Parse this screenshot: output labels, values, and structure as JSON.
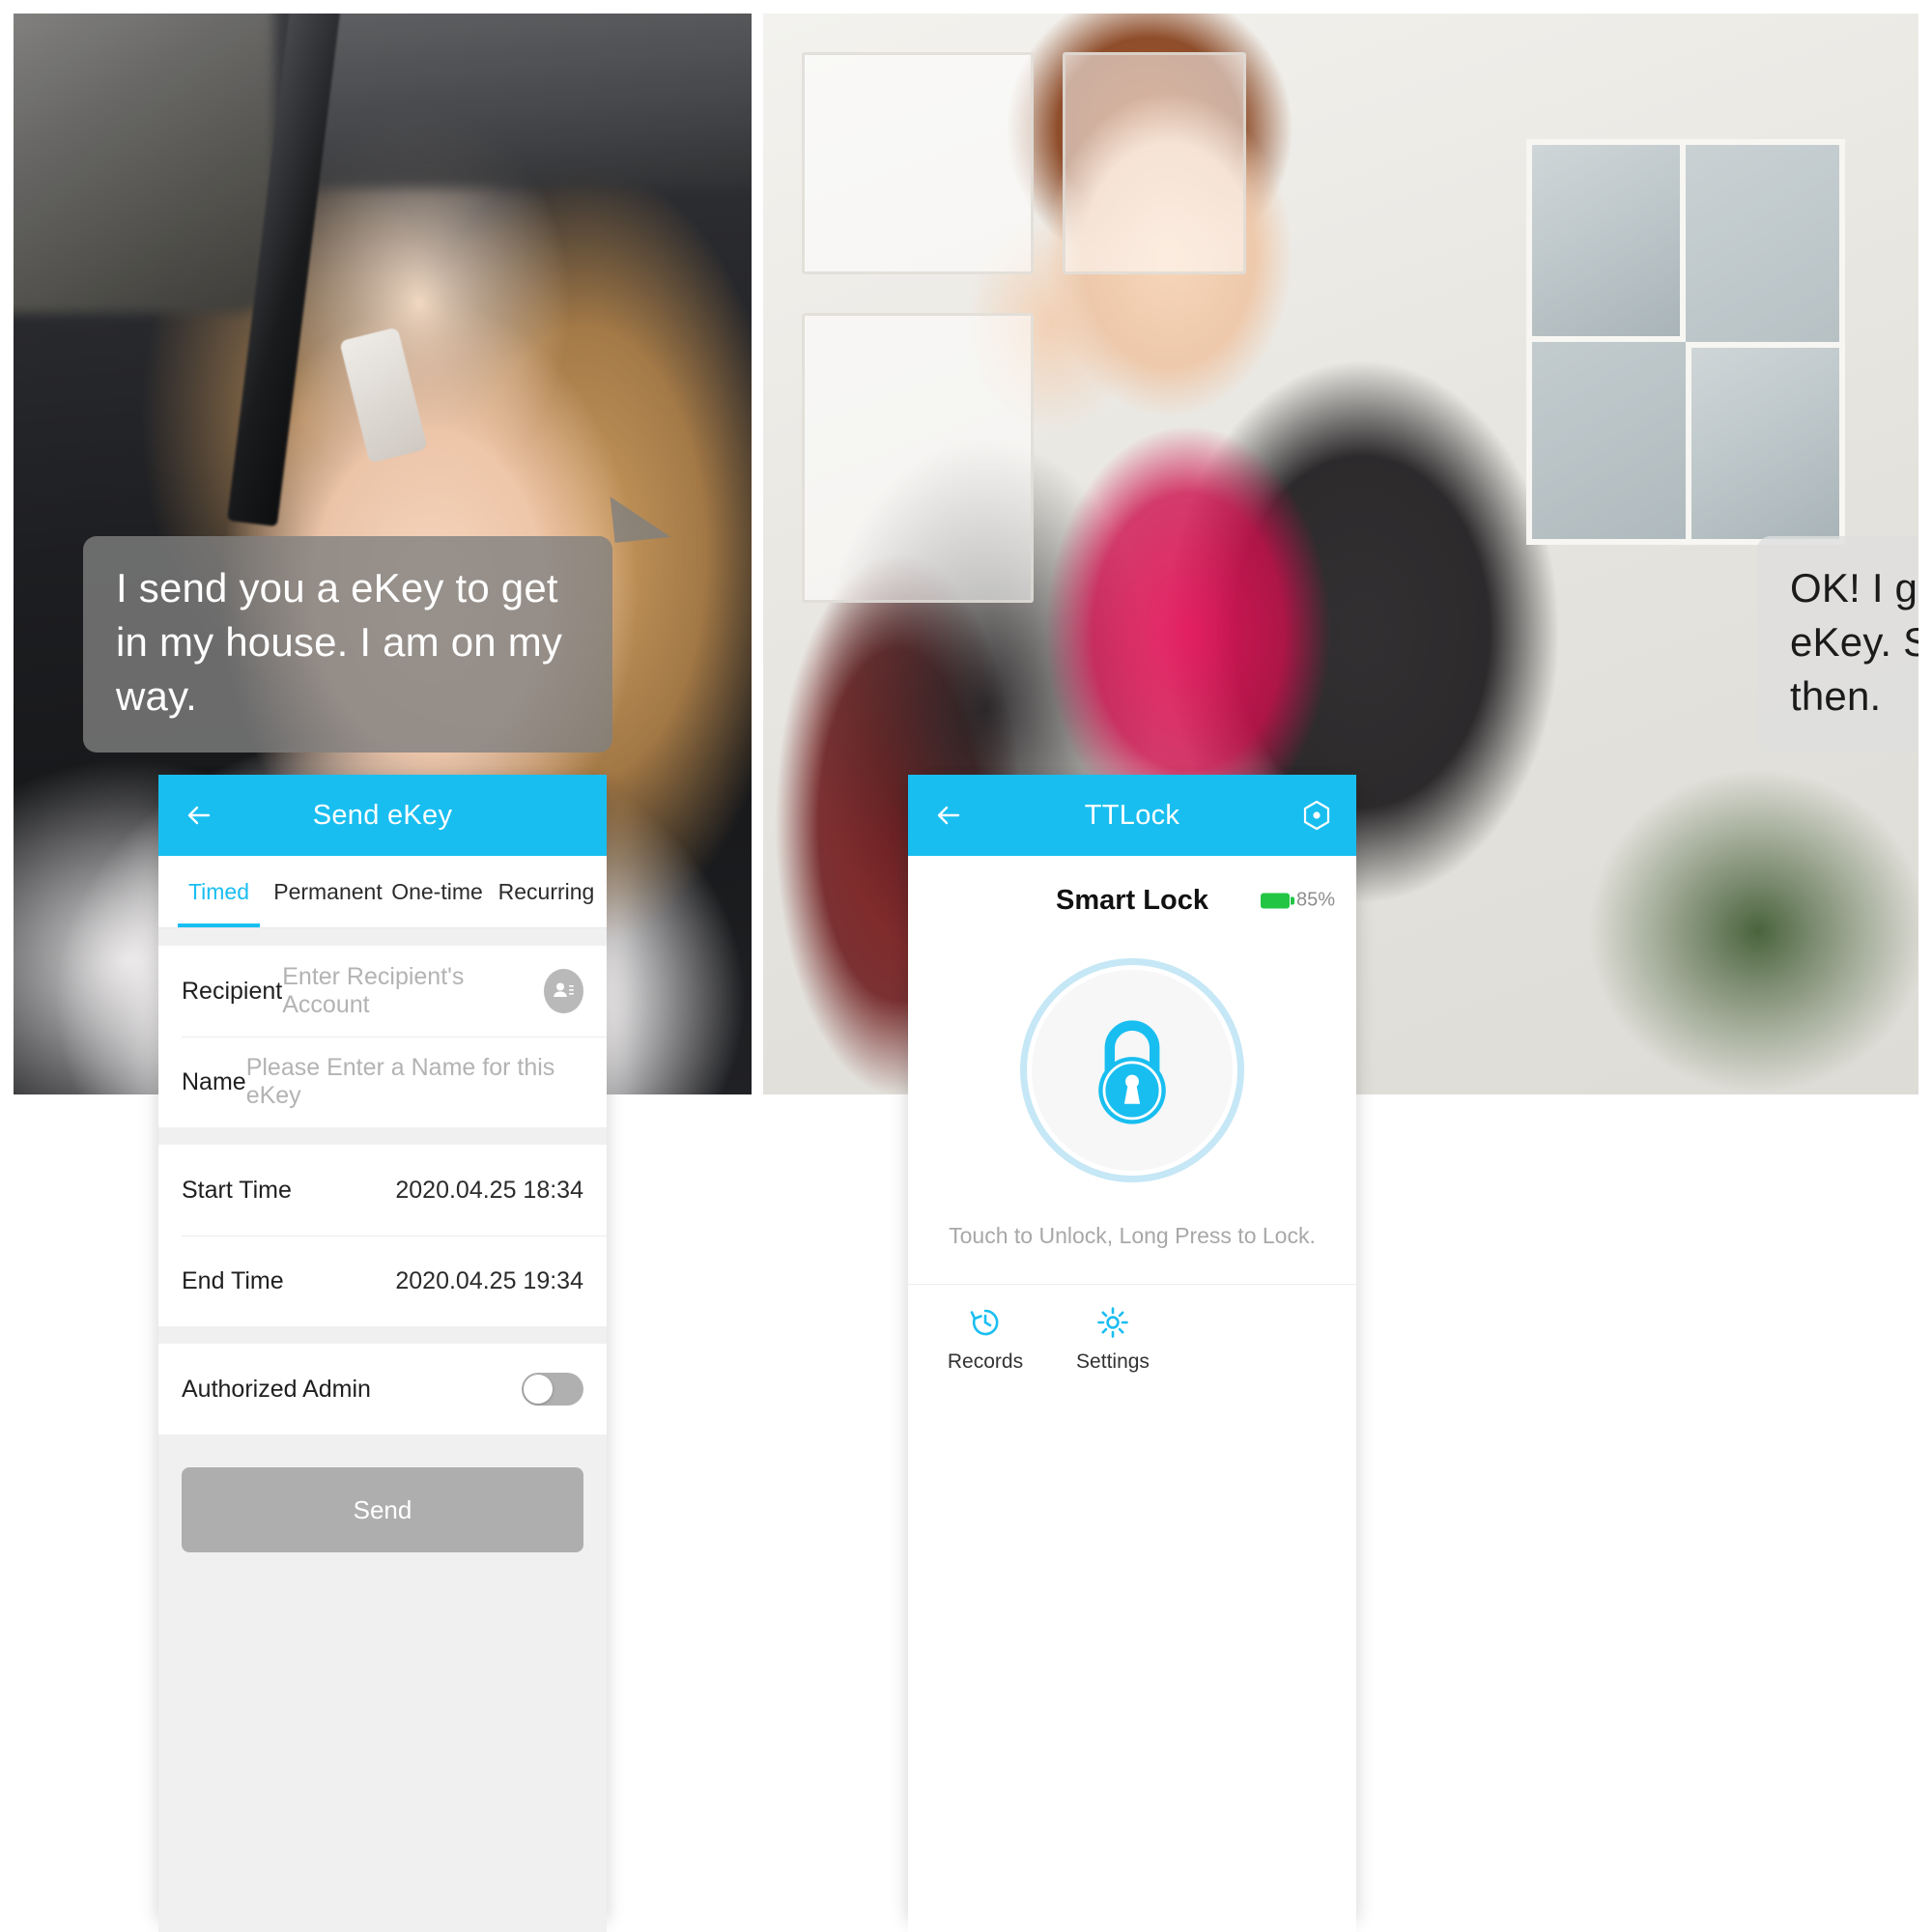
{
  "photos": {
    "left": {
      "alt": "woman-on-phone-in-car"
    },
    "right": {
      "alt": "woman-on-phone-at-front-door"
    }
  },
  "bubbles": {
    "left": {
      "text": "I send you a eKey to get in my house. I am on my way.",
      "bg": "#808080",
      "color": "#ffffff"
    },
    "right": {
      "text": "OK! I got the eKey. See you then.",
      "bg": "#dedede",
      "color": "#1b1b1b"
    }
  },
  "send_ekey_screen": {
    "appbar": {
      "title": "Send eKey",
      "back_icon": "arrow-left-icon",
      "accent": "#19bef0"
    },
    "tabs": [
      {
        "label": "Timed",
        "active": true
      },
      {
        "label": "Permanent",
        "active": false
      },
      {
        "label": "One-time",
        "active": false
      },
      {
        "label": "Recurring",
        "active": false
      }
    ],
    "fields": {
      "recipient": {
        "label": "Recipient",
        "value": "",
        "placeholder": "Enter Recipient's Account",
        "icon": "contact-person-icon"
      },
      "name": {
        "label": "Name",
        "value": "",
        "placeholder": "Please Enter a Name for this eKey"
      },
      "start_time": {
        "label": "Start Time",
        "value": "2020.04.25 18:34"
      },
      "end_time": {
        "label": "End Time",
        "value": "2020.04.25 19:34"
      },
      "authorized_admin": {
        "label": "Authorized Admin",
        "state": "off"
      }
    },
    "send_button": {
      "label": "Send",
      "enabled": false,
      "bg": "#aeaeae"
    }
  },
  "ttlock_screen": {
    "appbar": {
      "title": "TTLock",
      "back_icon": "arrow-left-icon",
      "action_icon": "hexagon-target-icon",
      "accent": "#19bef0"
    },
    "lock": {
      "name": "Smart Lock",
      "battery_percent": "85%",
      "battery_color": "#22c544",
      "icon": "padlock-icon",
      "hint": "Touch to Unlock, Long Press to Lock."
    },
    "bottom_nav": [
      {
        "label": "Records",
        "icon": "history-clock-icon",
        "color": "#19bef0"
      },
      {
        "label": "Settings",
        "icon": "gear-icon",
        "color": "#19bef0"
      }
    ]
  }
}
